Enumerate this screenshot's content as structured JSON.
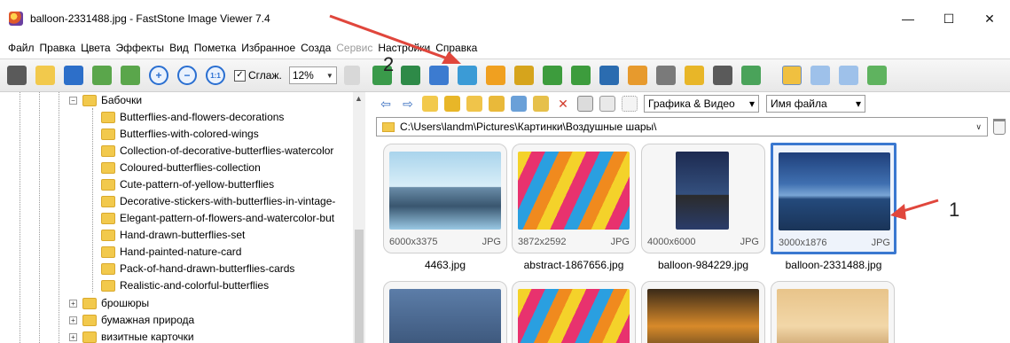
{
  "window": {
    "title": "balloon-2331488.jpg - FastStone Image Viewer 7.4",
    "minimize": "—",
    "maximize": "☐",
    "close": "✕"
  },
  "menu": [
    "Файл",
    "Правка",
    "Цвета",
    "Эффекты",
    "Вид",
    "Пометка",
    "Избранное",
    "Созда",
    "Сервис",
    "Настройки",
    "Справка"
  ],
  "toolbar": {
    "smooth_label": "Сглаж.",
    "smooth_check": "✓",
    "zoom_value": "12%",
    "zoom_arrow": "▼",
    "zoom_in_glyph": "+",
    "zoom_out_glyph": "−",
    "actual_size_glyph": "1:1"
  },
  "annotations": {
    "label_1": "1",
    "label_2": "2"
  },
  "tree": {
    "parent": "Бабочки",
    "parent_expander": "−",
    "children": [
      "Butterflies-and-flowers-decorations",
      "Butterflies-with-colored-wings",
      "Collection-of-decorative-butterflies-watercolor",
      "Coloured-butterflies-collection",
      "Cute-pattern-of-yellow-butterflies",
      "Decorative-stickers-with-butterflies-in-vintage-",
      "Elegant-pattern-of-flowers-and-watercolor-but",
      "Hand-drawn-butterflies-set",
      "Hand-painted-nature-card",
      "Pack-of-hand-drawn-butterflies-cards",
      "Realistic-and-colorful-butterflies"
    ],
    "siblings": [
      "брошюры",
      "бумажная природа",
      "визитные карточки"
    ],
    "sibling_expander": "+",
    "scroll_up": "▲"
  },
  "browser": {
    "filter_value": "Графика & Видео",
    "sort_value": "Имя файла",
    "dropdown_arrow": "▾",
    "path": "C:\\Users\\landm\\Pictures\\Картинки\\Воздушные шары\\",
    "path_arrow": "∨",
    "thumbnails": [
      {
        "name": "4463.jpg",
        "dims": "6000x3375",
        "type": "JPG"
      },
      {
        "name": "abstract-1867656.jpg",
        "dims": "3872x2592",
        "type": "JPG"
      },
      {
        "name": "balloon-984229.jpg",
        "dims": "4000x6000",
        "type": "JPG"
      },
      {
        "name": "balloon-2331488.jpg",
        "dims": "3000x1876",
        "type": "JPG",
        "selected": true
      }
    ]
  },
  "colors": {
    "selection_border": "#3a78d0",
    "annotation_arrow": "#e0463c",
    "folder": "#f2c94c"
  }
}
